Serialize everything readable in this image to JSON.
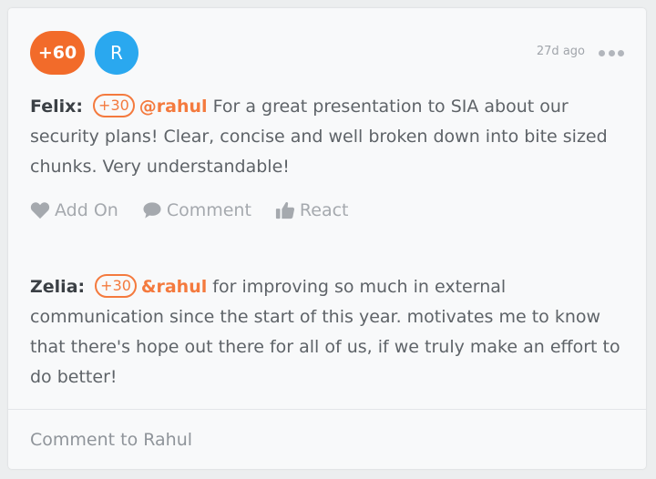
{
  "post": {
    "points_label": "+60",
    "avatar_initial": "R",
    "timestamp": "27d ago"
  },
  "entries": [
    {
      "author": "Felix:",
      "points": "+30",
      "mention": "@rahul",
      "message": " For a great presentation to SIA about our security plans! Clear, concise and well broken down into bite sized chunks. Very understandable!"
    },
    {
      "author": "Zelia:",
      "points": "+30",
      "mention": "&rahul",
      "message": " for improving so much in external communication since the start of this year. motivates me to know that there's hope out there for all of us, if we truly make an effort to do better!"
    }
  ],
  "actions": {
    "add_on": "Add On",
    "comment": "Comment",
    "react": "React"
  },
  "comment_box": {
    "placeholder": "Comment to Rahul"
  },
  "icons": {
    "add_on": "heart-icon",
    "comment": "speech-bubble-icon",
    "react": "thumbs-up-icon",
    "more": "ellipsis-icon"
  },
  "colors": {
    "points_pill": "#f26b2a",
    "avatar": "#2aa8ef",
    "accent": "#f47a3e",
    "action_gray": "#a5a9ae"
  }
}
